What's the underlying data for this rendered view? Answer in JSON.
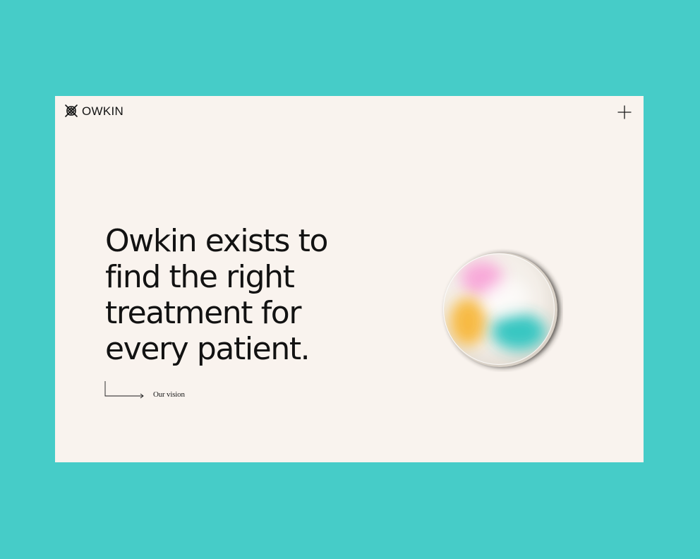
{
  "header": {
    "brand": "OWKIN",
    "logo_icon": "owkin-logo-icon",
    "menu_icon": "plus-icon"
  },
  "hero": {
    "headline": [
      "Owkin exists to",
      "find the right",
      "treatment for",
      "every patient."
    ],
    "cta_label": "Our vision",
    "cta_icon": "corner-arrow-right-icon",
    "visual": "gradient-orb-illustration"
  },
  "colors": {
    "backdrop": "#46ccc8",
    "page_background": "#f9f3ee",
    "text": "#121212",
    "orb_pink": "#f8a6d8",
    "orb_yellow": "#f7b73a",
    "orb_teal": "#2fc4c0"
  }
}
